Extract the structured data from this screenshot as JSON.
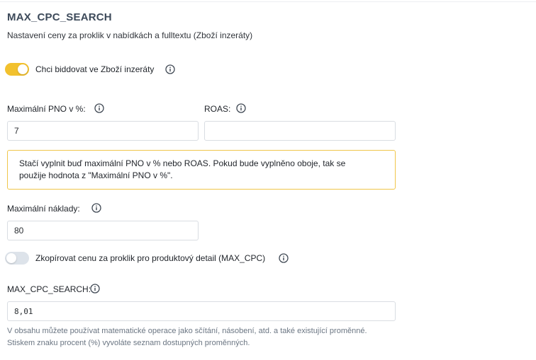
{
  "section": {
    "title": "MAX_CPC_SEARCH",
    "subtitle": "Nastavení ceny za proklik v nabídkách a fulltextu (Zboží inzeráty)"
  },
  "bid_toggle": {
    "label": "Chci biddovat ve Zboží inzeráty",
    "state": "on",
    "color": "#f2c12e"
  },
  "pno_field": {
    "label": "Maximální PNO v %:",
    "value": "7"
  },
  "roas_field": {
    "label": "ROAS:",
    "value": ""
  },
  "notice": {
    "line1": "Stačí vyplnit buď maximální PNO v % nebo ROAS. Pokud bude vyplněno oboje, tak se",
    "line2": "použije hodnota z \"Maximální PNO v %\".",
    "border_color": "#f0c64a"
  },
  "max_cost_field": {
    "label": "Maximální náklady:",
    "value": "80"
  },
  "copy_toggle": {
    "label": "Zkopírovat cenu za proklik pro produktový detail (MAX_CPC)",
    "state": "off"
  },
  "max_cpc_search_field": {
    "label": "MAX_CPC_SEARCH:",
    "value": "8,01"
  },
  "help_text": {
    "line1": "V obsahu můžete používat matematické operace jako sčítání, násobení, atd. a také existující proměnné.",
    "line2": "Stiskem znaku procent (%) vyvoláte seznam dostupných proměnných."
  },
  "icons": {
    "info": "info-circle-icon"
  }
}
